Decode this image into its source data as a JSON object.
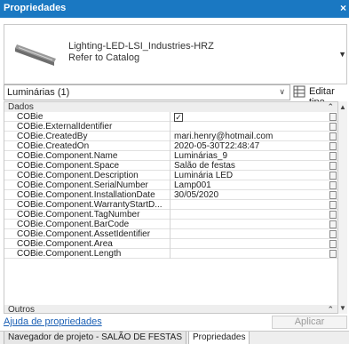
{
  "window": {
    "title": "Propriedades",
    "close_glyph": "×"
  },
  "type_selector": {
    "family": "Lighting-LED-LSI_Industries-HRZ",
    "type": "Refer to Catalog",
    "dropdown_icon": "dropdown-arrow-icon"
  },
  "instance_filter": {
    "value": "Luminárias (1)"
  },
  "edit_type": {
    "label": "Editar tipo",
    "icon": "edit-type-icon"
  },
  "properties": {
    "groups": [
      {
        "name": "Dados"
      },
      {
        "name": "Outros"
      }
    ],
    "rows": [
      {
        "name": "COBie",
        "value": "",
        "checked": true
      },
      {
        "name": "COBie.ExternalIdentifier",
        "value": ""
      },
      {
        "name": "COBie.CreatedBy",
        "value": "mari.henry@hotmail.com"
      },
      {
        "name": "COBie.CreatedOn",
        "value": "2020-05-30T22:48:47"
      },
      {
        "name": "COBie.Component.Name",
        "value": "Luminárias_9"
      },
      {
        "name": "COBie.Component.Space",
        "value": "Salão de festas"
      },
      {
        "name": "COBie.Component.Description",
        "value": "Luminária LED"
      },
      {
        "name": "COBie.Component.SerialNumber",
        "value": "Lamp001"
      },
      {
        "name": "COBie.Component.InstallationDate",
        "value": "30/05/2020"
      },
      {
        "name": "COBie.Component.WarrantyStartD...",
        "value": ""
      },
      {
        "name": "COBie.Component.TagNumber",
        "value": ""
      },
      {
        "name": "COBie.Component.BarCode",
        "value": ""
      },
      {
        "name": "COBie.Component.AssetIdentifier",
        "value": ""
      },
      {
        "name": "COBie.Component.Area",
        "value": ""
      },
      {
        "name": "COBie.Component.Length",
        "value": ""
      }
    ]
  },
  "footer": {
    "help_link": "Ajuda de propriedades",
    "apply_button": "Aplicar"
  },
  "tabs": [
    {
      "label": "Navegador de projeto - SALÃO DE FESTAS",
      "active": false
    },
    {
      "label": "Propriedades",
      "active": true
    }
  ],
  "colors": {
    "titlebar": "#1a78c2",
    "link": "#1a5fb4",
    "group_band": "#eeeeee"
  }
}
